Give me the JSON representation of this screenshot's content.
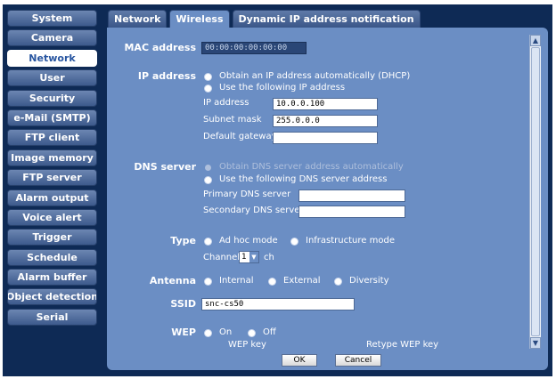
{
  "menu": {
    "items": [
      {
        "label": "System"
      },
      {
        "label": "Camera"
      },
      {
        "label": "Network"
      },
      {
        "label": "User"
      },
      {
        "label": "Security"
      },
      {
        "label": "e-Mail (SMTP)"
      },
      {
        "label": "FTP client"
      },
      {
        "label": "Image memory"
      },
      {
        "label": "FTP server"
      },
      {
        "label": "Alarm output"
      },
      {
        "label": "Voice alert"
      },
      {
        "label": "Trigger"
      },
      {
        "label": "Schedule"
      },
      {
        "label": "Alarm buffer"
      },
      {
        "label": "Object detection"
      },
      {
        "label": "Serial"
      }
    ],
    "active_index": 2
  },
  "tabs": [
    {
      "label": "Network"
    },
    {
      "label": "Wireless"
    },
    {
      "label": "Dynamic IP address notification"
    }
  ],
  "active_tab": 1,
  "form": {
    "mac": {
      "label": "MAC address",
      "value": "00:00:00:00:00:00"
    },
    "ip": {
      "label": "IP address",
      "opt_dhcp": "Obtain an IP address automatically (DHCP)",
      "opt_manual": "Use the following IP address",
      "ip_label": "IP address",
      "ip_value": "10.0.0.100",
      "mask_label": "Subnet mask",
      "mask_value": "255.0.0.0",
      "gateway_label": "Default gateway",
      "gateway_value": ""
    },
    "dns": {
      "label": "DNS server",
      "opt_auto": "Obtain DNS server address automatically",
      "opt_manual": "Use the following DNS server address",
      "primary_label": "Primary DNS server",
      "primary_value": "",
      "secondary_label": "Secondary DNS server",
      "secondary_value": ""
    },
    "type": {
      "label": "Type",
      "opt_adhoc": "Ad hoc mode",
      "opt_infra": "Infrastructure mode",
      "channel_label": "Channel",
      "channel_value": "1",
      "channel_unit": "ch"
    },
    "antenna": {
      "label": "Antenna",
      "opt_internal": "Internal",
      "opt_external": "External",
      "opt_diversity": "Diversity"
    },
    "ssid": {
      "label": "SSID",
      "value": "snc-cs50"
    },
    "wep": {
      "label": "WEP",
      "opt_on": "On",
      "opt_off": "Off",
      "key_label": "WEP key",
      "retype_label": "Retype WEP key"
    }
  },
  "buttons": {
    "ok": "OK",
    "cancel": "Cancel"
  },
  "colors": {
    "background": "#0e2a55",
    "panel": "#6b8ec4",
    "menu_button": "#4e6a9c",
    "active_menu": "#ffffff"
  }
}
